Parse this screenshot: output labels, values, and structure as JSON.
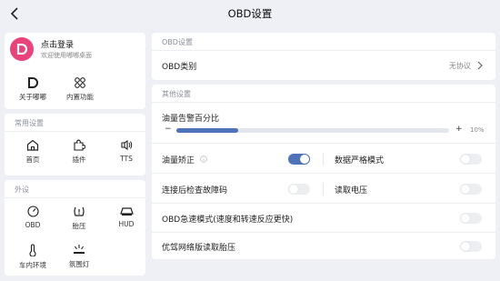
{
  "header": {
    "title": "OBD设置"
  },
  "profile": {
    "login": "点击登录",
    "welcome": "欢迎使用嘟嘟桌面"
  },
  "left_top": {
    "about": "关于嘟嘟",
    "builtin": "内置功能"
  },
  "common": {
    "label": "常用设置",
    "items": [
      "首页",
      "插件",
      "TTS"
    ]
  },
  "external": {
    "label": "外设",
    "items": [
      "OBD",
      "胎压",
      "HUD",
      "车内环境",
      "氛围灯"
    ]
  },
  "obd": {
    "section": "OBD设置",
    "type_label": "OBD类别",
    "type_value": "无协议"
  },
  "other": {
    "section": "其他设置",
    "fuel_warning": "油量告警百分比",
    "slider_minus": "−",
    "slider_plus": "+",
    "slider_value": "10%",
    "fuel_fraction": 0.1,
    "fuel_correction": "油量矫正",
    "strict_mode": "数据严格模式",
    "check_fault": "连接后检查故障码",
    "read_voltage": "读取电压",
    "fast_mode": "OBD急速模式(速度和转速反应更快)",
    "tpms_read": "优驾网络版读取胎压"
  },
  "toggles": {
    "fuel_correction": true,
    "strict_mode": false,
    "check_fault": false,
    "read_voltage": false,
    "fast_mode": false,
    "tpms_read": false
  },
  "colors": {
    "accent": "#4e73b8",
    "avatar": "#e8437a",
    "background": "#eef0f5"
  }
}
